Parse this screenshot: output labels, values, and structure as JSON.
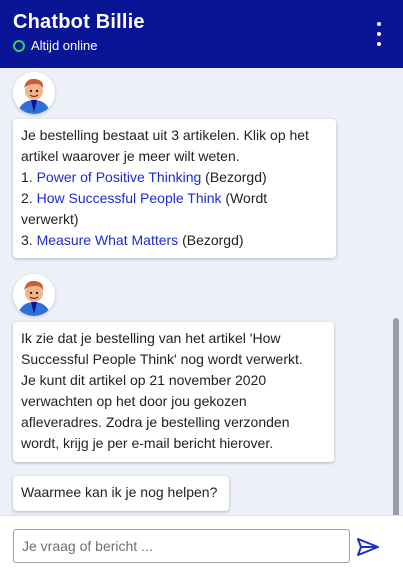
{
  "header": {
    "title": "Chatbot Billie",
    "status": "Altijd online"
  },
  "messages": {
    "m1": {
      "intro_line1": "Je bestelling bestaat uit 3 artikelen. Klik op het",
      "intro_line2": "artikel waarover je meer wilt weten.",
      "items": [
        {
          "num": "1. ",
          "title": "Power of Positive Thinking",
          "status": " (Bezorgd)"
        },
        {
          "num": "2. ",
          "title": "How Successful People Think",
          "status": " (Wordt",
          "status_cont": "verwerkt)"
        },
        {
          "num": "3. ",
          "title": "Measure What Matters",
          "status": " (Bezorgd)"
        }
      ]
    },
    "m2": {
      "lines": [
        "Ik zie dat je bestelling van het artikel 'How",
        "Successful People Think' nog wordt verwerkt.",
        "Je kunt dit artikel op 21 november 2020",
        "verwachten op het door jou gekozen",
        "afleveradres. Zodra je bestelling verzonden",
        "wordt, krijg je per e-mail bericht hierover."
      ]
    },
    "m3": {
      "text": "Waarmee kan ik je nog helpen?"
    }
  },
  "input": {
    "placeholder": "Je vraag of bericht ..."
  },
  "colors": {
    "header_bg": "#0a1596",
    "chat_bg": "#eef0f9",
    "link": "#1b2bd0",
    "online": "#2fd06a"
  },
  "icons": {
    "menu": "kebab-menu-icon",
    "send": "send-icon",
    "avatar": "bot-avatar"
  }
}
